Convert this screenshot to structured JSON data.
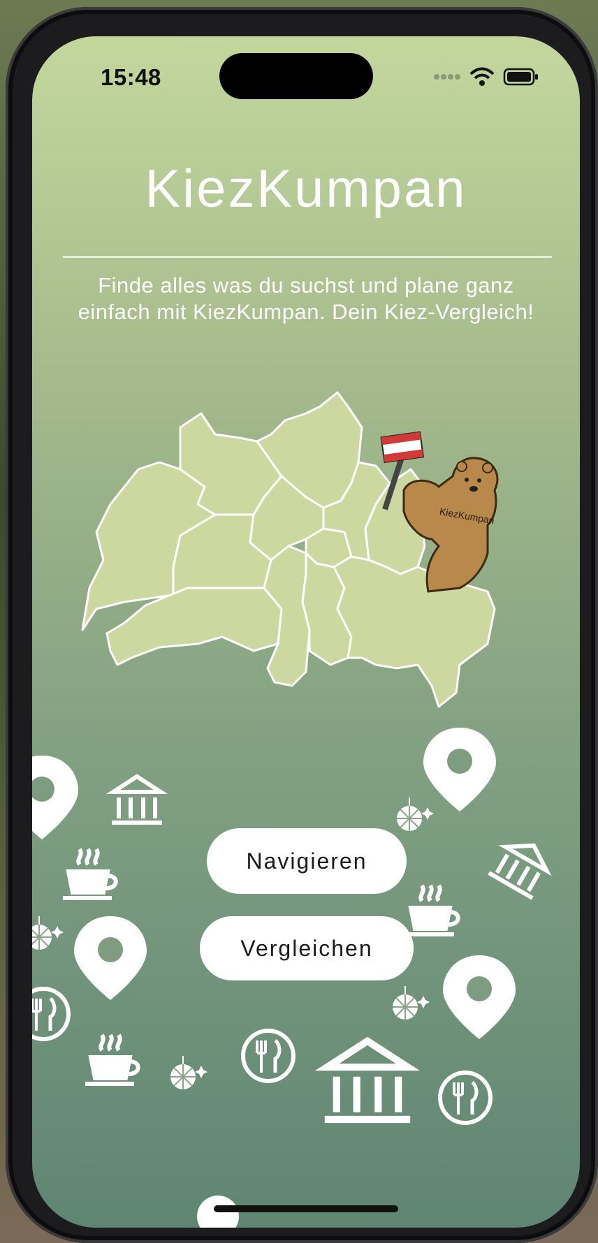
{
  "status_bar": {
    "time": "15:48"
  },
  "app": {
    "title": "KiezKumpan",
    "subtitle": "Finde alles was du suchst und plane ganz einfach mit KiezKumpan. Dein Kiez-Vergleich!"
  },
  "buttons": {
    "navigate": "Navigieren",
    "compare": "Vergleichen"
  },
  "mascot": {
    "shirt_text": "KiezKumpan"
  },
  "colors": {
    "gradient_top": "#c3d79d",
    "gradient_bottom": "#5f8573",
    "map_fill": "#ccd89f",
    "bear": "#b8894a"
  },
  "icons": [
    "map-pin-icon",
    "museum-icon",
    "coffee-cup-icon",
    "disco-ball-icon",
    "restaurant-icon",
    "wifi-icon",
    "battery-icon",
    "signal-icon"
  ]
}
